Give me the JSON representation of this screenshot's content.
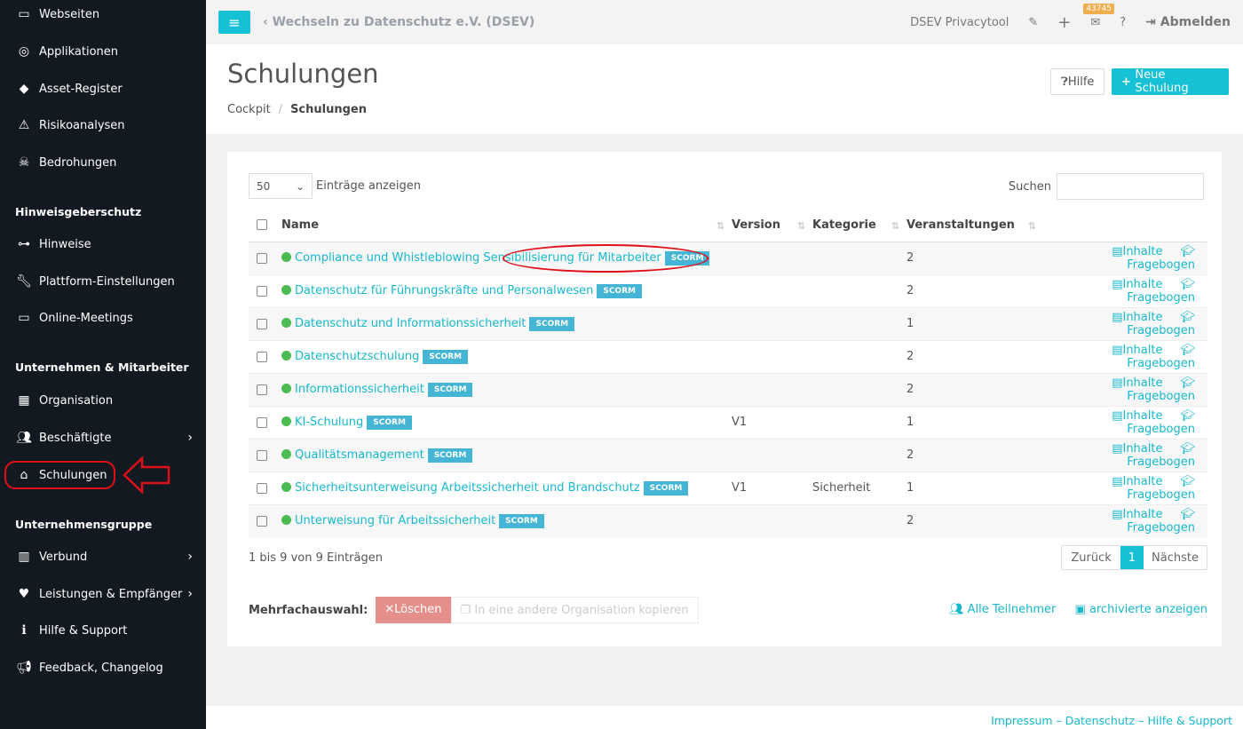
{
  "sidebar": {
    "items": [
      {
        "label": "Webseiten",
        "icon": "monitor-icon",
        "y": 16
      },
      {
        "label": "Applikationen",
        "icon": "disc-icon"
      },
      {
        "label": "Asset-Register",
        "icon": "diamond-icon"
      },
      {
        "label": "Risikoanalysen",
        "icon": "warning-icon"
      },
      {
        "label": "Bedrohungen",
        "icon": "skull-icon"
      }
    ],
    "heading1": "Hinweisgeberschutz",
    "items2": [
      {
        "label": "Hinweise"
      },
      {
        "label": "Plattform-Einstellungen"
      },
      {
        "label": "Online-Meetings"
      }
    ],
    "heading2": "Unternehmen & Mitarbeiter",
    "items3": [
      {
        "label": "Organisation"
      },
      {
        "label": "Beschäftigte"
      },
      {
        "label": "Schulungen"
      }
    ],
    "heading3": "Unternehmensgruppe",
    "items4": [
      {
        "label": "Verbund"
      },
      {
        "label": "Leistungen & Empfänger"
      },
      {
        "label": "Hilfe & Support"
      },
      {
        "label": "Feedback, Changelog"
      }
    ]
  },
  "topbar": {
    "switch": "Wechseln zu Datenschutz e.V. (DSEV)",
    "app": "DSEV Privacytool",
    "mail_count": "43745",
    "logout": "Abmelden"
  },
  "header": {
    "title": "Schulungen",
    "breadcrumb": [
      "Cockpit",
      "Schulungen"
    ],
    "help": "Hilfe",
    "new": "Neue Schulung"
  },
  "table": {
    "length": "50",
    "length_label": "Einträge anzeigen",
    "search_label": "Suchen",
    "columns": [
      "Name",
      "Version",
      "Kategorie",
      "Veranstaltungen"
    ],
    "badge": "SCORM",
    "inhalte": "Inhalte",
    "fragebogen": "Fragebogen",
    "rows": [
      {
        "name": "Compliance und Whistleblowing Sensibilisierung für Mitarbeiter",
        "version": "",
        "kategorie": "",
        "count": "2"
      },
      {
        "name": "Datenschutz für Führungskräfte und Personalwesen",
        "version": "",
        "kategorie": "",
        "count": "2"
      },
      {
        "name": "Datenschutz und Informationssicherheit",
        "version": "",
        "kategorie": "",
        "count": "1"
      },
      {
        "name": "Datenschutzschulung",
        "version": "",
        "kategorie": "",
        "count": "2"
      },
      {
        "name": "Informationssicherheit",
        "version": "",
        "kategorie": "",
        "count": "2"
      },
      {
        "name": "KI-Schulung",
        "version": "V1",
        "kategorie": "",
        "count": "1"
      },
      {
        "name": "Qualitätsmanagement",
        "version": "",
        "kategorie": "",
        "count": "2"
      },
      {
        "name": "Sicherheitsunterweisung Arbeitssicherheit und Brandschutz",
        "version": "V1",
        "kategorie": "Sicherheit",
        "count": "1"
      },
      {
        "name": "Unterweisung für Arbeitssicherheit",
        "version": "",
        "kategorie": "",
        "count": "2"
      }
    ],
    "info": "1 bis 9 von 9 Einträgen",
    "prev": "Zurück",
    "page": "1",
    "next": "Nächste"
  },
  "bulk": {
    "label": "Mehrfachauswahl:",
    "delete": "Löschen",
    "copy": "In eine andere Organisation kopieren",
    "all": "Alle Teilnehmer",
    "archived": "archivierte anzeigen"
  },
  "footer": {
    "impressum": "Impressum",
    "datenschutz": "Datenschutz",
    "hilfe": "Hilfe & Support"
  }
}
